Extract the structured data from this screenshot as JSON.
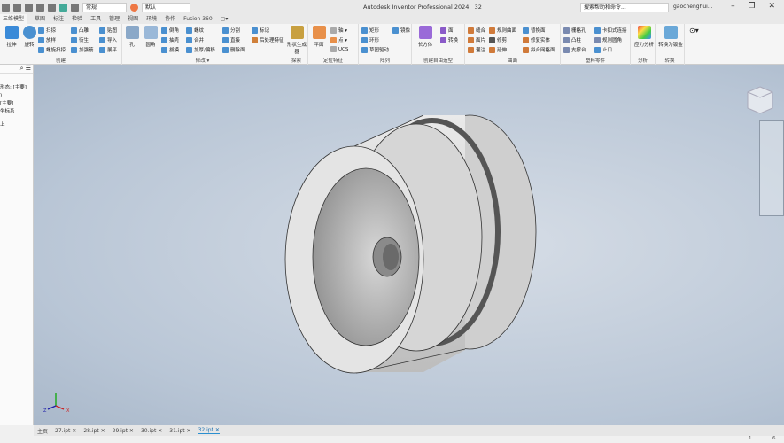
{
  "app": {
    "title": "Autodesk Inventor Professional 2024",
    "document": "32",
    "search_placeholder": "搜索帮助和命令...",
    "user": "gaochenghui...",
    "window_controls": "– ❐ ✕"
  },
  "qat": {
    "appearance": "常规",
    "material": "默认"
  },
  "tabs": [
    "三维模型",
    "草图",
    "标注",
    "检验",
    "工具",
    "管理",
    "视图",
    "环境",
    "协作",
    "Fusion 360",
    "▢▾"
  ],
  "panels": [
    {
      "label": "创建",
      "big": [
        "拉伸",
        "旋转"
      ],
      "small": [
        "扫掠",
        "放样",
        "螺旋扫掠",
        "凸雕",
        "衍生",
        "加强筋",
        "贴图",
        "导入",
        "展平"
      ]
    },
    {
      "label": "修改 ▾",
      "big": [
        "孔",
        "圆角"
      ],
      "small": [
        "倒角",
        "抽壳",
        "拔模",
        "螺纹",
        "合并",
        "加厚/偏移",
        "分割",
        "直接",
        "删除面",
        "标记",
        "后处理特征"
      ]
    },
    {
      "label": "探索",
      "big": [
        "形状生成器"
      ]
    },
    {
      "label": "定位特征",
      "big": [
        "平面"
      ],
      "small": [
        "轴 ▾",
        "点 ▾",
        "UCS"
      ]
    },
    {
      "label": "阵列",
      "small": [
        "矩形",
        "环形",
        "草图驱动",
        "镜像"
      ]
    },
    {
      "label": "创建自由造型",
      "big": [
        "长方体"
      ],
      "small": [
        "面",
        "转换"
      ]
    },
    {
      "label": "曲面",
      "small": [
        "缝合",
        "面片",
        "灌注",
        "规则曲面",
        "修剪",
        "延伸",
        "替换面",
        "修复实体",
        "拟合网格面"
      ]
    },
    {
      "label": "塑料零件",
      "small": [
        "栅格孔",
        "凸柱",
        "支撑台",
        "卡扣式连接",
        "规则圆角",
        "止口"
      ]
    },
    {
      "label": "分析",
      "big": [
        "应力分析"
      ]
    },
    {
      "label": "转换",
      "big": [
        "转换为钣金"
      ]
    }
  ],
  "browser": {
    "lines": [
      "形态: [主要]",
      ")",
      "[主要]",
      "坐标系",
      "",
      "原点",
      "上"
    ]
  },
  "doc_tabs": [
    "主页",
    "27.ipt ✕",
    "28.ipt ✕",
    "29.ipt ✕",
    "30.ipt ✕",
    "31.ipt ✕",
    "32.ipt ✕"
  ],
  "status": {
    "count1": "1",
    "count2": "6"
  },
  "triad": {
    "x": "X",
    "y": "Y",
    "z": "Z"
  },
  "colors": {
    "viewport": "#b9c6d6",
    "accent": "#2a8fd0",
    "part": "#d4d4d4"
  }
}
